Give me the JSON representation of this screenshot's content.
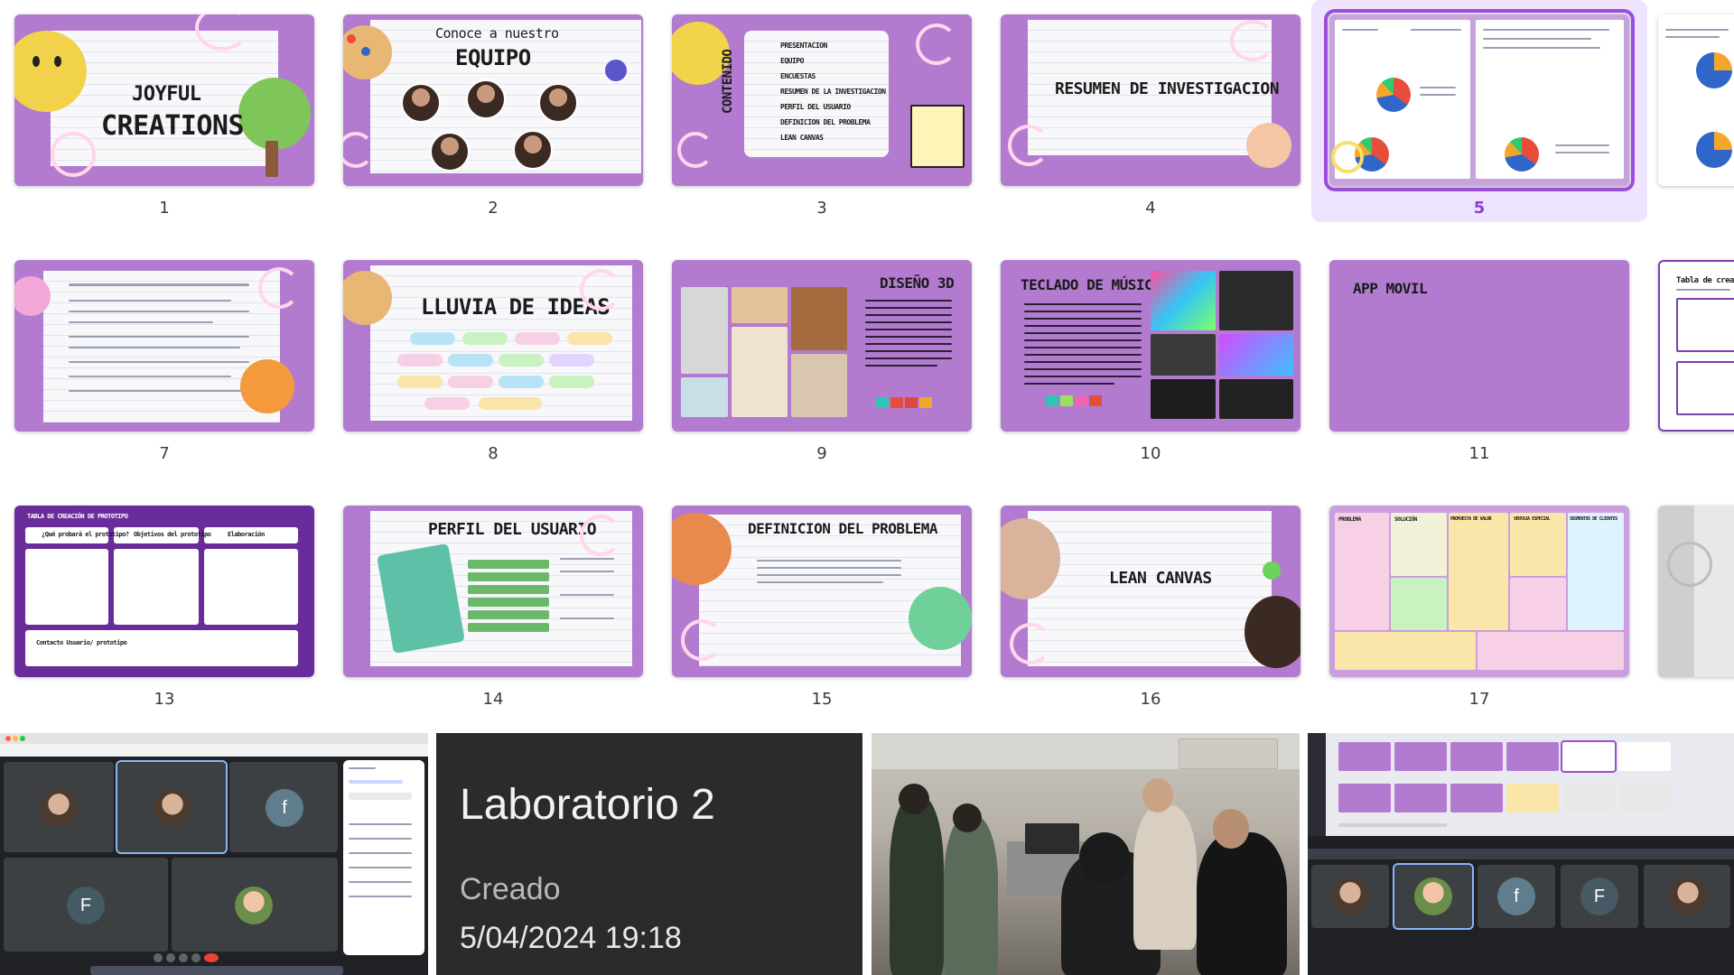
{
  "slides": [
    {
      "num": "1",
      "title_line1": "JOYFUL",
      "title_line2": "CREATIONS"
    },
    {
      "num": "2",
      "title_line1": "Conoce a nuestro",
      "title_line2": "EQUIPO"
    },
    {
      "num": "3",
      "side_title": "CONTENIDO",
      "items": [
        "PRESENTACION",
        "EQUIPO",
        "ENCUESTAS",
        "RESUMEN DE LA INVESTIGACION",
        "PERFIL DEL USUARIO",
        "DEFINICION DEL PROBLEMA",
        "LEAN CANVAS"
      ]
    },
    {
      "num": "4",
      "title": "RESUMEN DE INVESTIGACION"
    },
    {
      "num": "5",
      "selected": true
    },
    {
      "num": "7"
    },
    {
      "num": "8",
      "title": "LLUVIA DE IDEAS"
    },
    {
      "num": "9",
      "title": "DISEÑO 3D"
    },
    {
      "num": "10",
      "title": "TECLADO DE MÚSICA"
    },
    {
      "num": "11",
      "title": "APP MOVIL"
    },
    {
      "num": "13",
      "title": "TABLA DE CREACIÓN DE PROTOTIPO",
      "col1": "¿Qué probará el prototipo?",
      "col2": "Objetivos del prototipo",
      "col3": "Elaboración",
      "row": "Contacto Usuario/ prototipo"
    },
    {
      "num": "14",
      "title": "PERFIL DEL USUARIO"
    },
    {
      "num": "15",
      "title": "DEFINICION DEL PROBLEMA"
    },
    {
      "num": "16",
      "title": "LEAN CANVAS"
    },
    {
      "num": "17",
      "headers": [
        "PROBLEMA",
        "SOLUCIÓN",
        "PROPUESTA DE VALOR",
        "VENTAJA ESPECIAL",
        "SEGMENTOS DE CLIENTES"
      ]
    }
  ],
  "partial": {
    "right_top_title": "",
    "right_mid_title": "Tabla de creación"
  },
  "card": {
    "title": "Laboratorio 2",
    "label": "Creado",
    "date": "5/04/2024 19:18"
  },
  "meet": {
    "avatars": [
      "f",
      "F"
    ]
  },
  "colors": {
    "slide_purple": "#b27bcf",
    "selected_outline": "#9b4fd9",
    "selected_bg": "#efe4ff",
    "meet_bg": "#202124"
  }
}
